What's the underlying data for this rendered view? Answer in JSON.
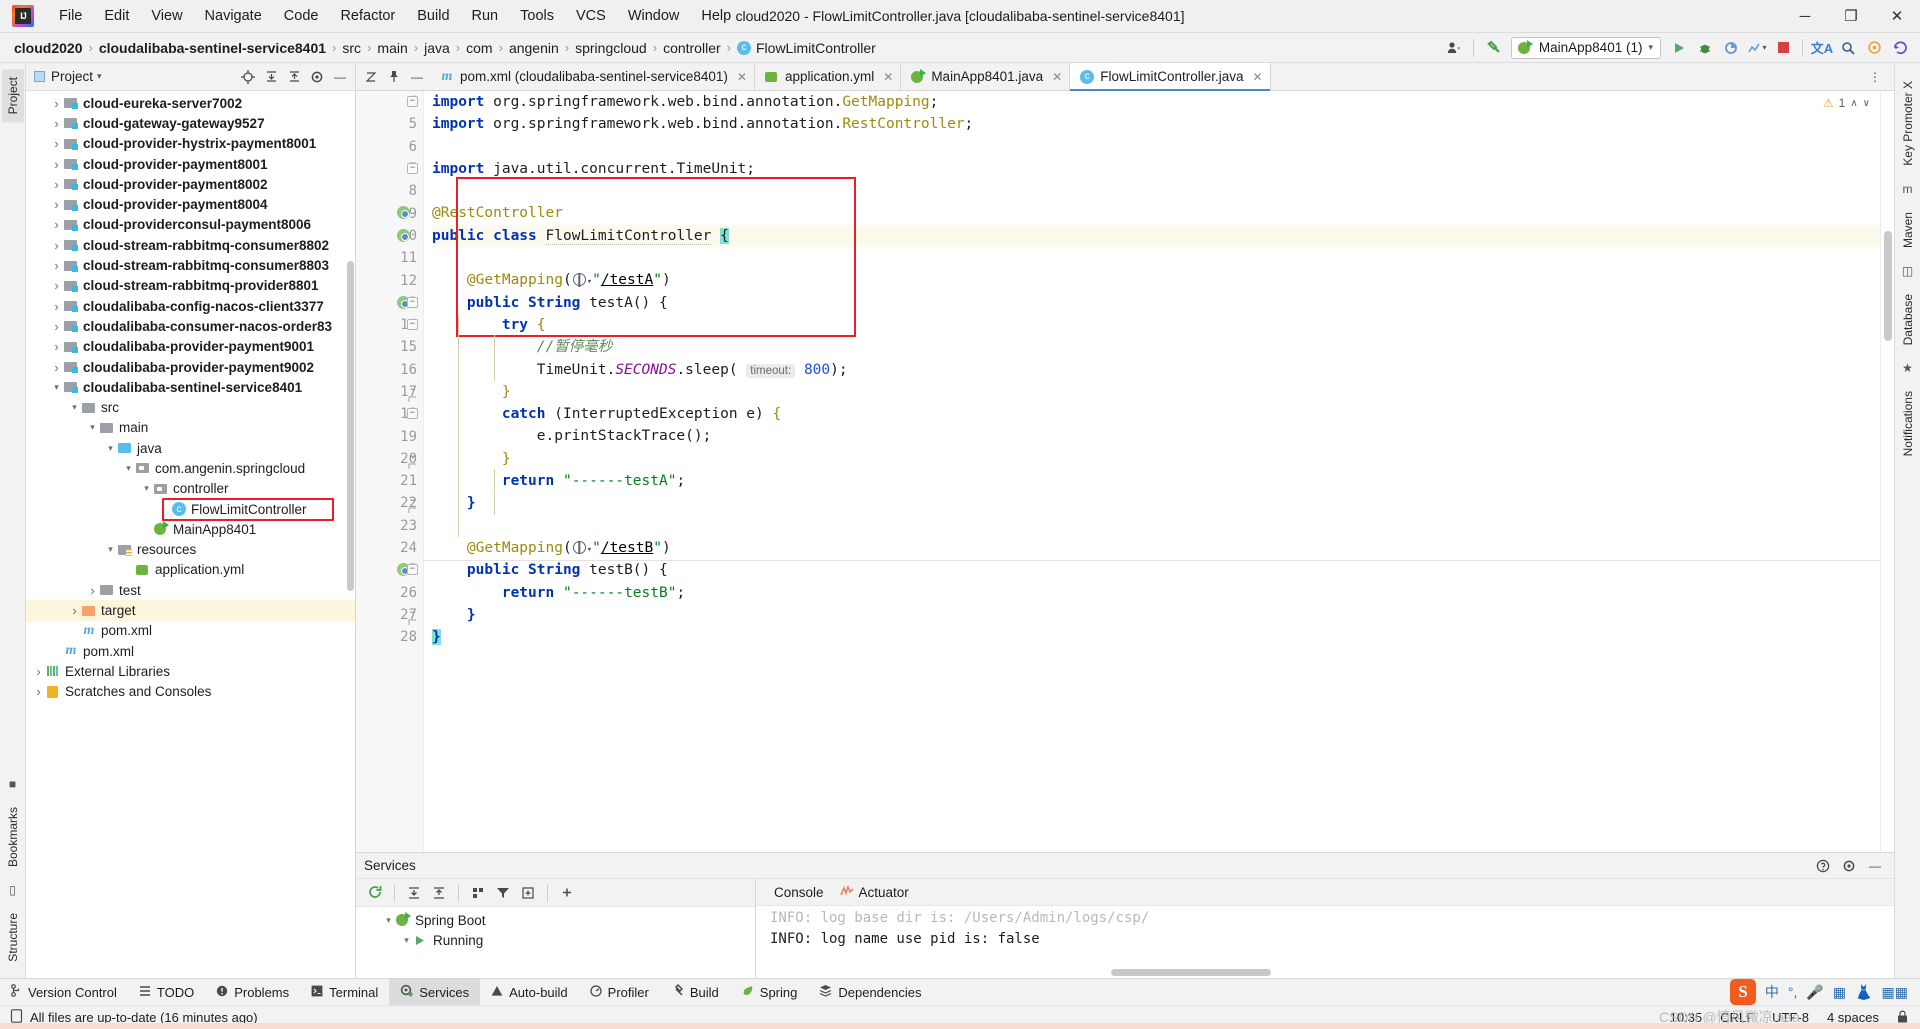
{
  "window": {
    "title": "cloud2020 - FlowLimitController.java [cloudalibaba-sentinel-service8401]",
    "minimize": "─",
    "maximize": "❐",
    "close": "✕"
  },
  "menubar": {
    "items": [
      "File",
      "Edit",
      "View",
      "Navigate",
      "Code",
      "Refactor",
      "Build",
      "Run",
      "Tools",
      "VCS",
      "Window",
      "Help"
    ]
  },
  "breadcrumb": {
    "items": [
      {
        "label": "cloud2020",
        "bold": true
      },
      {
        "label": "cloudalibaba-sentinel-service8401",
        "bold": true
      },
      {
        "label": "src",
        "bold": false
      },
      {
        "label": "main",
        "bold": false
      },
      {
        "label": "java",
        "bold": false
      },
      {
        "label": "com",
        "bold": false
      },
      {
        "label": "angenin",
        "bold": false
      },
      {
        "label": "springcloud",
        "bold": false
      },
      {
        "label": "controller",
        "bold": false
      },
      {
        "label": "FlowLimitController",
        "bold": false
      }
    ],
    "separator": "›"
  },
  "toolbar": {
    "run_config": "MainApp8401 (1)",
    "dropdown_caret": "▾",
    "icons": [
      "user-icon",
      "hammer-icon",
      "run-icon",
      "debug-icon",
      "coverage-icon",
      "profile-icon",
      "stop-icon",
      "translate-icon",
      "search-icon",
      "settings-icon",
      "updates-icon"
    ]
  },
  "left_rail": {
    "tabs": [
      "Project"
    ],
    "bottom_tabs": [
      "Bookmarks",
      "Structure"
    ]
  },
  "right_rail": {
    "tabs": [
      "Key Promoter X",
      "Maven",
      "Database",
      "Notifications"
    ]
  },
  "project_panel": {
    "title": "Project",
    "dropdown_caret": "▾",
    "header_icons": [
      "locate-icon",
      "expand-all-icon",
      "collapse-all-icon",
      "gear-icon",
      "hide-icon"
    ],
    "tree": [
      {
        "indent": 1,
        "arrow": "right",
        "icon": "module-icon",
        "label": "cloud-eureka-server7002",
        "bold": true
      },
      {
        "indent": 1,
        "arrow": "right",
        "icon": "module-icon",
        "label": "cloud-gateway-gateway9527",
        "bold": true
      },
      {
        "indent": 1,
        "arrow": "right",
        "icon": "module-icon",
        "label": "cloud-provider-hystrix-payment8001",
        "bold": true
      },
      {
        "indent": 1,
        "arrow": "right",
        "icon": "module-icon",
        "label": "cloud-provider-payment8001",
        "bold": true
      },
      {
        "indent": 1,
        "arrow": "right",
        "icon": "module-icon",
        "label": "cloud-provider-payment8002",
        "bold": true
      },
      {
        "indent": 1,
        "arrow": "right",
        "icon": "module-icon",
        "label": "cloud-provider-payment8004",
        "bold": true
      },
      {
        "indent": 1,
        "arrow": "right",
        "icon": "module-icon",
        "label": "cloud-providerconsul-payment8006",
        "bold": true
      },
      {
        "indent": 1,
        "arrow": "right",
        "icon": "module-icon",
        "label": "cloud-stream-rabbitmq-consumer8802",
        "bold": true
      },
      {
        "indent": 1,
        "arrow": "right",
        "icon": "module-icon",
        "label": "cloud-stream-rabbitmq-consumer8803",
        "bold": true
      },
      {
        "indent": 1,
        "arrow": "right",
        "icon": "module-icon",
        "label": "cloud-stream-rabbitmq-provider8801",
        "bold": true
      },
      {
        "indent": 1,
        "arrow": "right",
        "icon": "module-icon",
        "label": "cloudalibaba-config-nacos-client3377",
        "bold": true
      },
      {
        "indent": 1,
        "arrow": "right",
        "icon": "module-icon",
        "label": "cloudalibaba-consumer-nacos-order83",
        "bold": true
      },
      {
        "indent": 1,
        "arrow": "right",
        "icon": "module-icon",
        "label": "cloudalibaba-provider-payment9001",
        "bold": true
      },
      {
        "indent": 1,
        "arrow": "right",
        "icon": "module-icon",
        "label": "cloudalibaba-provider-payment9002",
        "bold": true
      },
      {
        "indent": 1,
        "arrow": "down",
        "icon": "module-icon",
        "label": "cloudalibaba-sentinel-service8401",
        "bold": true
      },
      {
        "indent": 2,
        "arrow": "down",
        "icon": "folder-icon",
        "label": "src",
        "bold": false
      },
      {
        "indent": 3,
        "arrow": "down",
        "icon": "folder-icon",
        "label": "main",
        "bold": false
      },
      {
        "indent": 4,
        "arrow": "down",
        "icon": "folder-blue-icon",
        "label": "java",
        "bold": false
      },
      {
        "indent": 5,
        "arrow": "down",
        "icon": "package-icon",
        "label": "com.angenin.springcloud",
        "bold": false
      },
      {
        "indent": 6,
        "arrow": "down",
        "icon": "package-icon",
        "label": "controller",
        "bold": false
      },
      {
        "indent": 7,
        "arrow": "none",
        "icon": "class-icon",
        "label": "FlowLimitController",
        "bold": false,
        "highlight_box": true
      },
      {
        "indent": 6,
        "arrow": "none",
        "icon": "spring-app-icon",
        "label": "MainApp8401",
        "bold": false
      },
      {
        "indent": 4,
        "arrow": "down",
        "icon": "folder-resources-icon",
        "label": "resources",
        "bold": false
      },
      {
        "indent": 5,
        "arrow": "none",
        "icon": "yml-icon",
        "label": "application.yml",
        "bold": false
      },
      {
        "indent": 3,
        "arrow": "right",
        "icon": "folder-icon",
        "label": "test",
        "bold": false
      },
      {
        "indent": 2,
        "arrow": "right",
        "icon": "folder-orange-icon",
        "label": "target",
        "bold": false,
        "row_highlight": true
      },
      {
        "indent": 2,
        "arrow": "none",
        "icon": "maven-icon",
        "label": "pom.xml",
        "bold": false
      },
      {
        "indent": 1,
        "arrow": "none",
        "icon": "maven-icon",
        "label": "pom.xml",
        "bold": false
      },
      {
        "indent": 0,
        "arrow": "right",
        "icon": "library-icon",
        "label": "External Libraries",
        "bold": false
      },
      {
        "indent": 0,
        "arrow": "right",
        "icon": "scratch-icon",
        "label": "Scratches and Consoles",
        "bold": false
      }
    ]
  },
  "editor": {
    "tabs": [
      {
        "icon": "maven-icon",
        "label": "pom.xml (cloudalibaba-sentinel-service8401)",
        "active": false,
        "close": "✕"
      },
      {
        "icon": "yml-icon",
        "label": "application.yml",
        "active": false,
        "close": "✕"
      },
      {
        "icon": "spring-app-icon",
        "label": "MainApp8401.java",
        "active": false,
        "close": "✕"
      },
      {
        "icon": "class-icon",
        "label": "FlowLimitController.java",
        "active": true,
        "close": "✕"
      }
    ],
    "inspection": {
      "warning_count": "1",
      "warning_icon": "warning-triangle-icon",
      "caret_up": "∧",
      "caret_down": "∨"
    },
    "lines": [
      {
        "n": 4,
        "marker": "",
        "fold": "open"
      },
      {
        "n": 5,
        "marker": "",
        "fold": ""
      },
      {
        "n": 6,
        "marker": "",
        "fold": ""
      },
      {
        "n": 7,
        "marker": "",
        "fold": "open"
      },
      {
        "n": 8,
        "marker": "",
        "fold": ""
      },
      {
        "n": 9,
        "marker": "spring",
        "fold": ""
      },
      {
        "n": 10,
        "marker": "spring",
        "fold": "",
        "highlight": true
      },
      {
        "n": 11,
        "marker": "",
        "fold": ""
      },
      {
        "n": 12,
        "marker": "",
        "fold": ""
      },
      {
        "n": 13,
        "marker": "spring",
        "fold": "open"
      },
      {
        "n": 14,
        "marker": "",
        "fold": "open"
      },
      {
        "n": 15,
        "marker": "",
        "fold": ""
      },
      {
        "n": 16,
        "marker": "",
        "fold": ""
      },
      {
        "n": 17,
        "marker": "",
        "fold": "end"
      },
      {
        "n": 18,
        "marker": "",
        "fold": "open"
      },
      {
        "n": 19,
        "marker": "",
        "fold": ""
      },
      {
        "n": 20,
        "marker": "",
        "fold": "end"
      },
      {
        "n": 21,
        "marker": "",
        "fold": ""
      },
      {
        "n": 22,
        "marker": "",
        "fold": "end"
      },
      {
        "n": 23,
        "marker": "",
        "fold": ""
      },
      {
        "n": 24,
        "marker": "",
        "fold": ""
      },
      {
        "n": 25,
        "marker": "spring",
        "fold": "open"
      },
      {
        "n": 26,
        "marker": "",
        "fold": ""
      },
      {
        "n": 27,
        "marker": "",
        "fold": "end"
      },
      {
        "n": 28,
        "marker": "",
        "fold": ""
      }
    ],
    "code_text": [
      "import org.springframework.web.bind.annotation.GetMapping;",
      "import org.springframework.web.bind.annotation.RestController;",
      "",
      "import java.util.concurrent.TimeUnit;",
      "",
      "@RestController",
      "public class FlowLimitController {",
      "",
      "    @GetMapping(\"/testA\")",
      "    public String testA() {",
      "        try {",
      "            //暂停毫秒",
      "            TimeUnit.SECONDS.sleep( timeout: 800);",
      "        }",
      "        catch (InterruptedException e) {",
      "            e.printStackTrace();",
      "        }",
      "        return \"------testA\";",
      "    }",
      "",
      "    @GetMapping(\"/testB\")",
      "    public String testB() {",
      "        return \"------testB\";",
      "    }",
      "}"
    ],
    "param_hint": "timeout:",
    "sleep_value": "800"
  },
  "services": {
    "title": "Services",
    "header_icons": [
      "help-icon",
      "gear-icon",
      "hide-icon"
    ],
    "toolbar_icons": [
      "rerun-icon",
      "expand-all-icon",
      "collapse-all-icon",
      "group-icon",
      "filter-icon",
      "add-tab-icon",
      "add-icon"
    ],
    "tree": [
      {
        "indent": 0,
        "arrow": "down",
        "icon": "spring-boot-icon",
        "label": "Spring Boot"
      },
      {
        "indent": 1,
        "arrow": "down",
        "icon": "run-icon",
        "label": "Running"
      }
    ],
    "tabs": [
      {
        "label": "Console",
        "icon": "console-icon",
        "active": true
      },
      {
        "label": "Actuator",
        "icon": "actuator-icon",
        "active": false
      }
    ],
    "console_lines": [
      "INFO: log base dir is: /Users/Admin/logs/csp/",
      "INFO: log name use pid is: false"
    ]
  },
  "bottom_tabs": {
    "items": [
      {
        "label": "Version Control",
        "icon": "branch-icon",
        "active": false
      },
      {
        "label": "TODO",
        "icon": "todo-icon",
        "active": false
      },
      {
        "label": "Problems",
        "icon": "problems-icon",
        "active": false
      },
      {
        "label": "Terminal",
        "icon": "terminal-icon",
        "active": false
      },
      {
        "label": "Services",
        "icon": "services-icon",
        "active": true
      },
      {
        "label": "Auto-build",
        "icon": "autobuild-icon",
        "active": false
      },
      {
        "label": "Profiler",
        "icon": "profiler-icon",
        "active": false
      },
      {
        "label": "Build",
        "icon": "build-icon",
        "active": false
      },
      {
        "label": "Spring",
        "icon": "spring-icon",
        "active": false
      },
      {
        "label": "Dependencies",
        "icon": "dependencies-icon",
        "active": false
      }
    ],
    "tray": [
      "sogou-icon",
      "chinese-input-icon",
      "punctuation-icon",
      "voice-icon",
      "keyboard-icon",
      "skin-icon",
      "apps-icon"
    ],
    "tray_chinese": "中"
  },
  "statusbar": {
    "message": "All files are up-to-date (16 minutes ago)",
    "message_icon": "document-icon",
    "time": "10:35",
    "line_separator": "CRLF",
    "encoding": "UTF-8",
    "indent": "4 spaces",
    "lock_icon": "lock-icon",
    "watermark": "CSDN @情风微凉.aaa"
  },
  "colors": {
    "accent_blue": "#4a88c7",
    "highlight_red": "#ee1c25",
    "keyword_blue": "#0033b3",
    "string_green": "#067d17",
    "annotation_gold": "#9e880d",
    "row_highlight_yellow": "#fdf6dd",
    "spring_green": "#6db33f"
  }
}
